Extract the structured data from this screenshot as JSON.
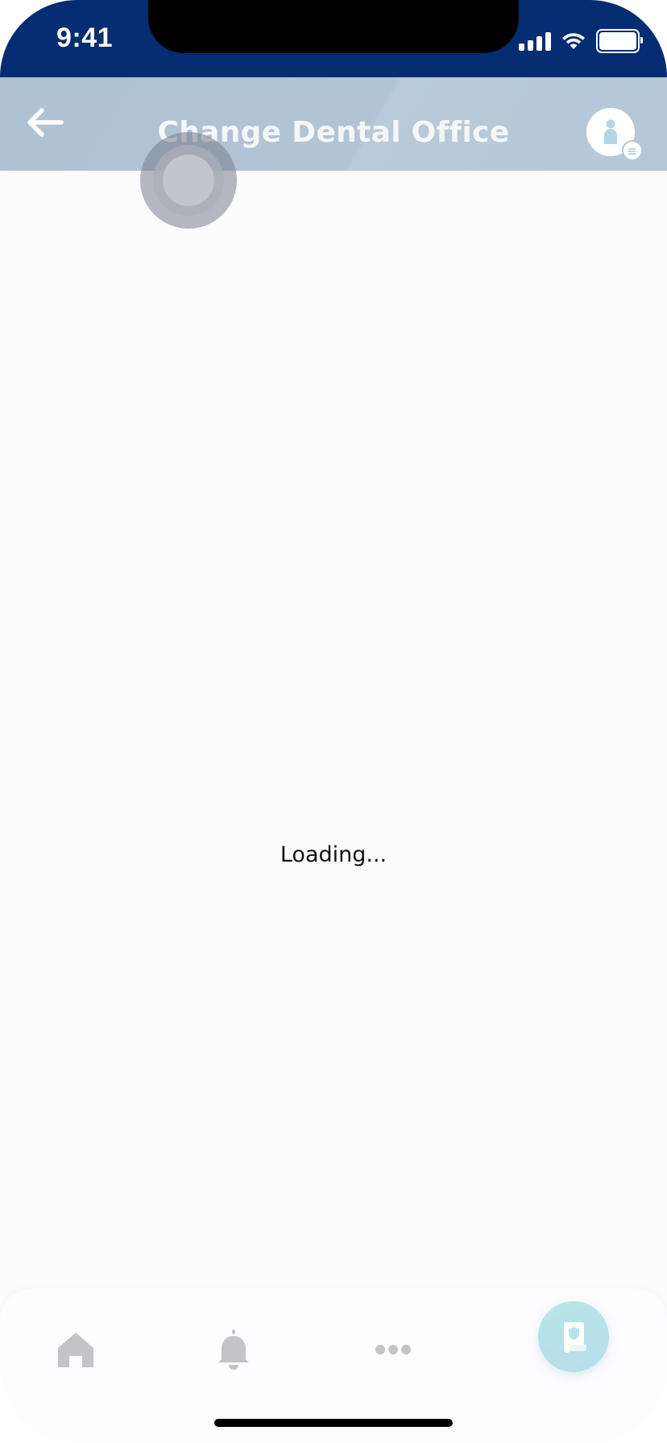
{
  "status_bar": {
    "time": "9:41"
  },
  "header": {
    "title": "Change Dental Office"
  },
  "main": {
    "loading_text": "Loading..."
  },
  "tab_bar": {
    "items": [
      {
        "icon": "home-icon",
        "active": false
      },
      {
        "icon": "bell-icon",
        "active": false
      },
      {
        "icon": "more-dots-icon",
        "active": false
      },
      {
        "icon": "insurance-card-icon",
        "active": true
      }
    ]
  },
  "colors": {
    "status_bar_bg": "#062c72",
    "header_bg": "#b2c4d4",
    "active_tab": "#b5e5e7",
    "inactive_icon": "#c4c4c6"
  }
}
